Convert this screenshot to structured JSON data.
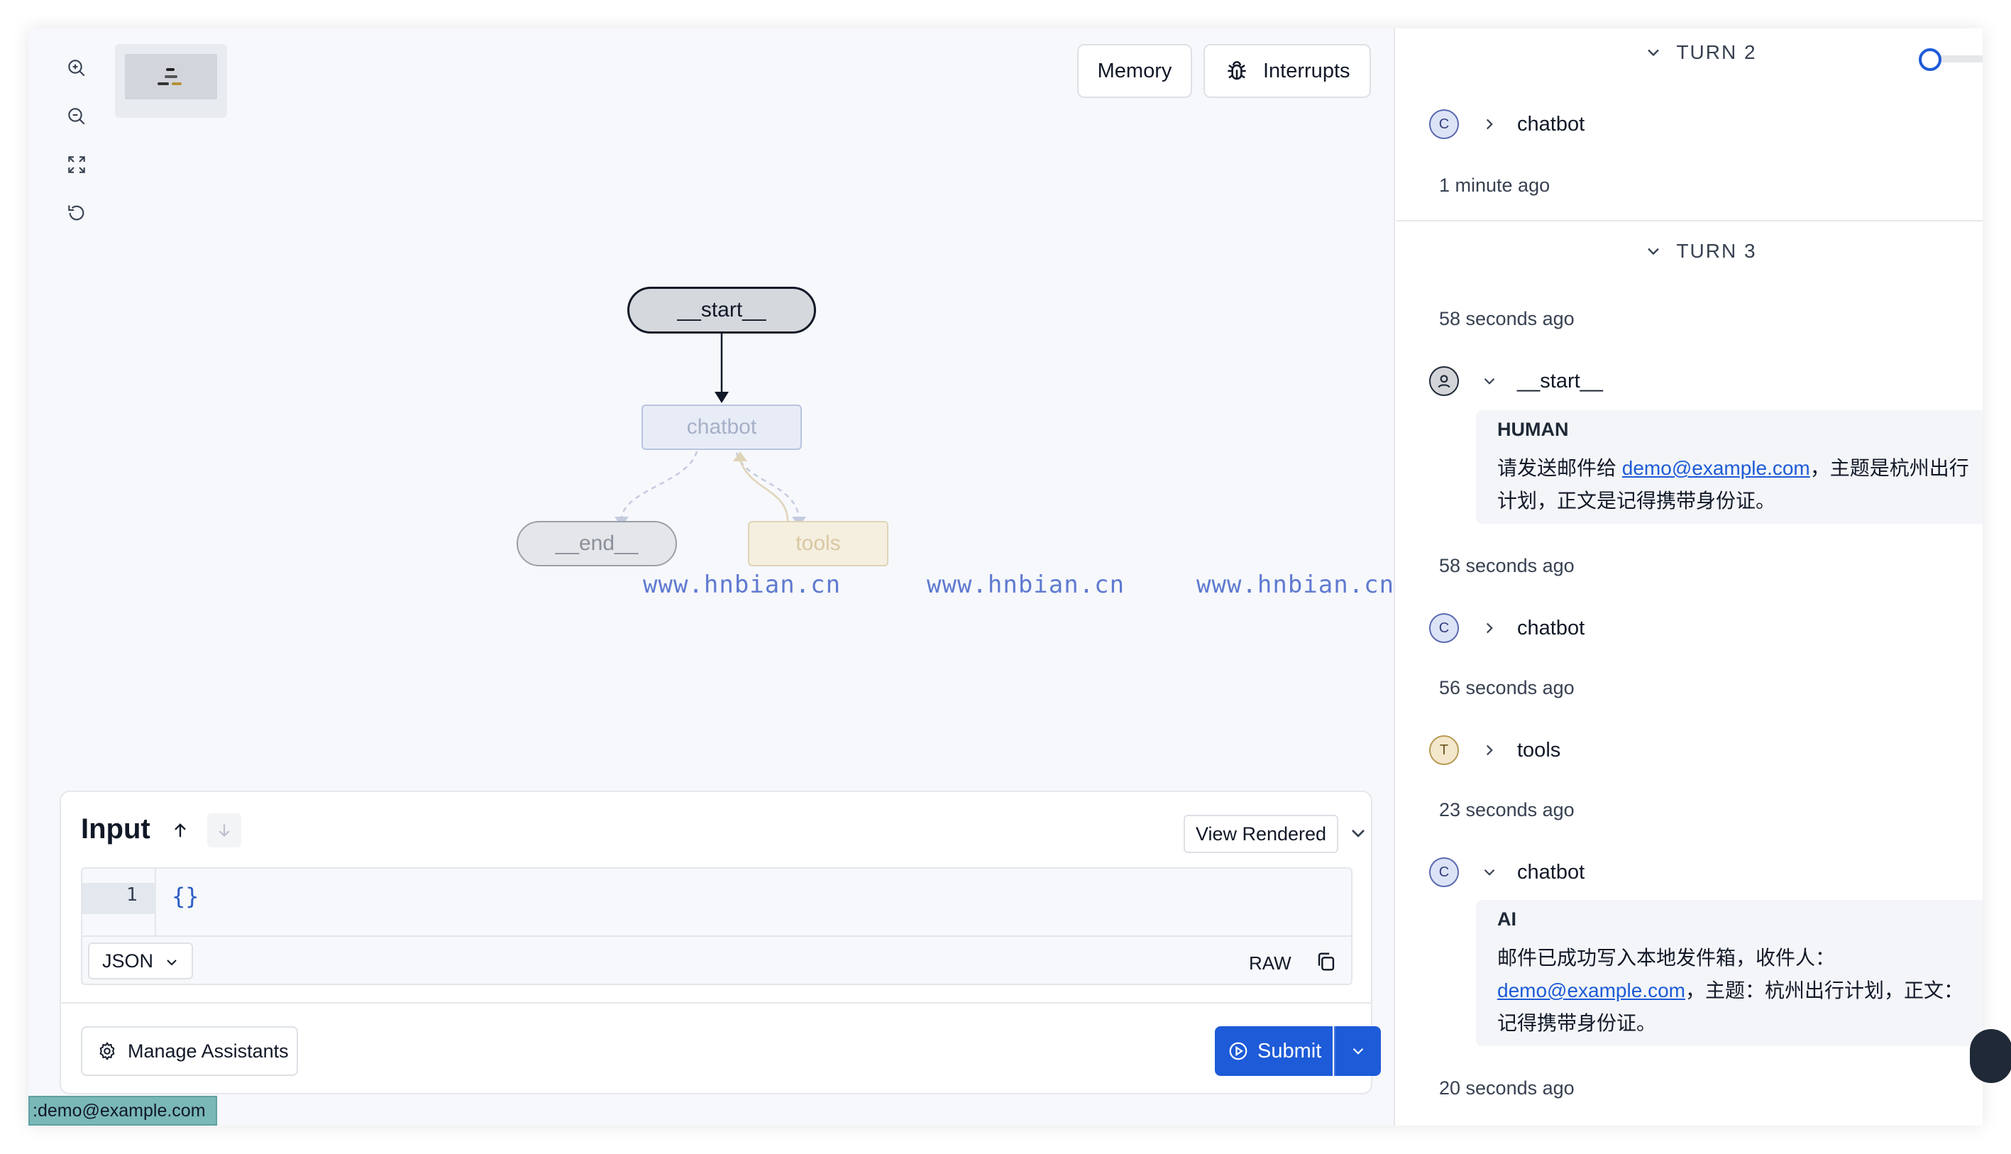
{
  "toolbar": {
    "memory_label": "Memory",
    "interrupts_label": "Interrupts"
  },
  "graph": {
    "nodes": {
      "start": "__start__",
      "chatbot": "chatbot",
      "end": "__end__",
      "tools": "tools"
    },
    "watermarks": [
      "www.hnbian.cn",
      "www.hnbian.cn",
      "www.hnbian.cn"
    ]
  },
  "input_panel": {
    "title": "Input",
    "view_mode": "View Rendered",
    "line_number": "1",
    "code": "{}",
    "format": "JSON",
    "raw_label": "RAW",
    "manage_label": "Manage Assistants",
    "submit_label": "Submit"
  },
  "status_bar": {
    "url": ":demo@example.com"
  },
  "sidebar": {
    "turn2": {
      "header": "TURN 2",
      "node": "chatbot",
      "time": "1 minute ago"
    },
    "turn3": {
      "header": "TURN 3",
      "time0": "58 seconds ago",
      "start_node": "__start__",
      "human": {
        "role": "HUMAN",
        "text_pre": "请发送邮件给 ",
        "link": "demo@example.com",
        "text_post": "，主题是杭州出行计划，正文是记得携带身份证。"
      },
      "time1": "58 seconds ago",
      "chatbot_node_1": "chatbot",
      "time2": "56 seconds ago",
      "tools_node": "tools",
      "time3": "23 seconds ago",
      "chatbot_node_2": "chatbot",
      "ai": {
        "role": "AI",
        "text_pre": "邮件已成功写入本地发件箱，收件人：",
        "link": "demo@example.com",
        "text_post": "，主题：杭州出行计划，正文：记得携带身份证。"
      },
      "time4": "20 seconds ago"
    },
    "avatars": {
      "chatbot": "C",
      "tools": "T"
    }
  },
  "colors": {
    "accent": "#1d5bd8",
    "canvas_bg": "#f6f8fb",
    "watermark": "#5f7ad0"
  }
}
